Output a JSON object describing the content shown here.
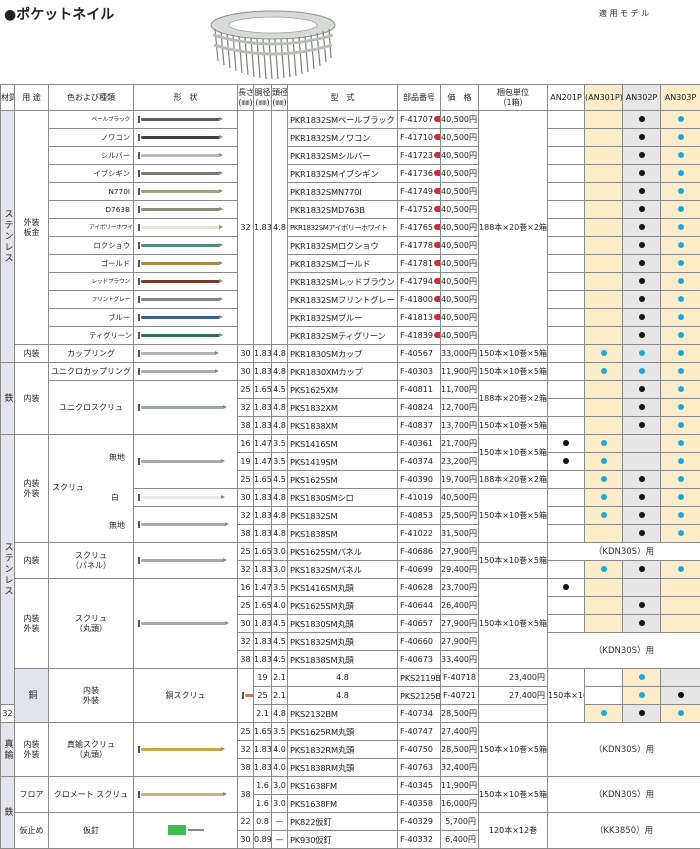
{
  "title": "●ポケットネイル",
  "headers": {
    "material": "材質",
    "use": "用 途",
    "color_type": "色および種類",
    "shape": "形　状",
    "length": "長さ",
    "length_unit": "(㎜)",
    "shank": "胴径",
    "shank_unit": "(㎜)",
    "head": "頭径",
    "head_unit": "(㎜)",
    "model": "型　式",
    "part_no": "部品番号",
    "price": "価　格",
    "package": "梱包単位",
    "package_sub": "（1箱）",
    "applicable": "適 用 モ デ ル",
    "models": [
      "AN201P",
      "(AN301P)",
      "AN302P",
      "AN303P"
    ]
  },
  "materials": {
    "stainless": "ステンレス",
    "iron": "鉄",
    "copper": "銅",
    "brass": "真鍮"
  },
  "uses": {
    "exterior_board": "外装\n板金",
    "interior": "内装",
    "interior_exterior": "内装\n外装",
    "floor": "フロア",
    "temp_stop": "仮止め"
  },
  "types": {
    "ring": "リング",
    "cup_ring": "カップリング",
    "unichro_cup_ring": "ユニクロカップリング",
    "unichro_screw": "ユニクロスクリュ",
    "screw": "スクリュ",
    "screw_panel": "スクリュ\n（パネル）",
    "screw_round": "スクリュ\n（丸頭）",
    "copper_screw": "銅スクリュ",
    "brass_screw": "真鍮スクリュ\n（丸頭）",
    "chromate_screw": "クロメート スクリュ",
    "temp_nail": "仮釘",
    "plain": "無地",
    "white": "白"
  },
  "ring_rows": [
    {
      "color": "ペールブラック",
      "model": "PKR1832SMペールブラック",
      "part": "F-41707",
      "price": "40,500円"
    },
    {
      "color": "ノワコン",
      "model": "PKR1832SMノワコン",
      "part": "F-41710",
      "price": "40,500円"
    },
    {
      "color": "シルバー",
      "model": "PKR1832SMシルバー",
      "part": "F-41723",
      "price": "40,500円"
    },
    {
      "color": "イブシギン",
      "model": "PKR1832SMイブシギン",
      "part": "F-41736",
      "price": "40,500円"
    },
    {
      "color": "N770I",
      "model": "PKR1832SMN770I",
      "part": "F-41749",
      "price": "40,500円"
    },
    {
      "color": "D763B",
      "model": "PKR1832SMD763B",
      "part": "F-41752",
      "price": "40,500円"
    },
    {
      "color": "アイボリーホワイト",
      "model": "PKR1832SMアイボリーホワイト",
      "part": "F-41765",
      "price": "40,500円"
    },
    {
      "color": "ロクショウ",
      "model": "PKR1832SMロクショウ",
      "part": "F-41778",
      "price": "40,500円"
    },
    {
      "color": "ゴールド",
      "model": "PKR1832SMゴールド",
      "part": "F-41781",
      "price": "40,500円"
    },
    {
      "color": "レッドブラウン",
      "model": "PKR1832SMレッドブラウン",
      "part": "F-41794",
      "price": "40,500円"
    },
    {
      "color": "フリントグレー",
      "model": "PKR1832SMフリントグレー",
      "part": "F-41800",
      "price": "40,500円"
    },
    {
      "color": "ブルー",
      "model": "PKR1832SMブルー",
      "part": "F-41813",
      "price": "40,500円"
    },
    {
      "color": "ティグリーン",
      "model": "PKR1832SMティグリーン",
      "part": "F-41839",
      "price": "40,500円"
    }
  ],
  "ring_dims": {
    "length": "32",
    "shank": "1.83",
    "head": "4.8",
    "package": "188本×20巻×2箱"
  },
  "cup_row": {
    "length": "30",
    "shank": "1.83",
    "head": "4.8",
    "model": "PKR1830SMカップ",
    "part": "F-40567",
    "price": "33,000円",
    "package": "150本×10巻×5箱"
  },
  "iron_rows": [
    {
      "length": "30",
      "shank": "1.83",
      "head": "4.8",
      "model": "PKR1830XMカップ",
      "part": "F-40303",
      "price": "11,900円",
      "package": "150本×10巻×5箱"
    },
    {
      "length": "25",
      "shank": "1.65",
      "head": "4.5",
      "model": "PKS1625XM",
      "part": "F-40811",
      "price": "11,700円",
      "package": "188本×20巻×2箱"
    },
    {
      "length": "32",
      "shank": "1.83",
      "head": "4.8",
      "model": "PKS1832XM",
      "part": "F-40824",
      "price": "12,700円"
    },
    {
      "length": "38",
      "shank": "1.83",
      "head": "4.8",
      "model": "PKS1838XM",
      "part": "F-40837",
      "price": "13,700円",
      "package": "150本×10巻×5箱"
    }
  ],
  "screw_rows": [
    {
      "length": "16",
      "shank": "1.47",
      "head": "3.5",
      "model": "PKS1416SM",
      "part": "F-40361",
      "price": "21,700円"
    },
    {
      "length": "19",
      "shank": "1.47",
      "head": "3.5",
      "model": "PKS1419SM",
      "part": "F-40374",
      "price": "23,200円"
    },
    {
      "length": "25",
      "shank": "1.65",
      "head": "4.5",
      "model": "PKS1625SM",
      "part": "F-40390",
      "price": "19,700円"
    },
    {
      "length": "30",
      "shank": "1.83",
      "head": "4.8",
      "model": "PKS1830SMシロ",
      "part": "F-41019",
      "price": "40,500円"
    },
    {
      "length": "32",
      "shank": "1.83",
      "head": "4.8",
      "model": "PKS1832SM",
      "part": "F-40853",
      "price": "25,500円"
    },
    {
      "length": "38",
      "shank": "1.83",
      "head": "4.8",
      "model": "PKS1838SM",
      "part": "F-41022",
      "price": "31,500円"
    }
  ],
  "screw_packages": {
    "p1": "150本×10巻×5箱",
    "p2": "188本×20巻×2箱",
    "p3": "150本×10巻×5箱"
  },
  "panel_rows": [
    {
      "length": "25",
      "shank": "1.65",
      "head": "3.0",
      "model": "PKS1625SMパネル",
      "part": "F-40686",
      "price": "27,900円"
    },
    {
      "length": "32",
      "shank": "1.83",
      "head": "3.0",
      "model": "PKS1832SMパネル",
      "part": "F-40699",
      "price": "29,400円"
    }
  ],
  "round_rows": [
    {
      "length": "16",
      "shank": "1.47",
      "head": "3.5",
      "model": "PKS1416SM丸頭",
      "part": "F-40628",
      "price": "23,700円"
    },
    {
      "length": "25",
      "shank": "1.65",
      "head": "4.0",
      "model": "PKS1625SM丸頭",
      "part": "F-40644",
      "price": "26,400円"
    },
    {
      "length": "30",
      "shank": "1.83",
      "head": "4.5",
      "model": "PKS1830SM丸頭",
      "part": "F-40657",
      "price": "27,900円"
    },
    {
      "length": "32",
      "shank": "1.83",
      "head": "4.5",
      "model": "PKS1832SM丸頭",
      "part": "F-40660",
      "price": "27,900円"
    },
    {
      "length": "38",
      "shank": "1.83",
      "head": "4.5",
      "model": "PKS1838SM丸頭",
      "part": "F-40673",
      "price": "33,400円"
    }
  ],
  "copper_rows": [
    {
      "length": "19",
      "shank": "2.1",
      "head": "4.8",
      "model": "PKS2119BM",
      "part": "F-40718",
      "price": "23,400円"
    },
    {
      "length": "25",
      "shank": "2.1",
      "head": "4.8",
      "model": "PKS2125BM",
      "part": "F-40721",
      "price": "27,400円"
    },
    {
      "length": "32",
      "shank": "2.1",
      "head": "4.8",
      "model": "PKS2132BM",
      "part": "F-40734",
      "price": "28,500円"
    }
  ],
  "brass_rows": [
    {
      "length": "25",
      "shank": "1.65",
      "head": "3.5",
      "model": "PKS1625RM丸頭",
      "part": "F-40747",
      "price": "27,400円"
    },
    {
      "length": "32",
      "shank": "1.83",
      "head": "4.0",
      "model": "PKS1832RM丸頭",
      "part": "F-40750",
      "price": "28,500円"
    },
    {
      "length": "38",
      "shank": "1.83",
      "head": "4.0",
      "model": "PKS1838RM丸頭",
      "part": "F-40763",
      "price": "32,400円"
    }
  ],
  "floor_rows": [
    {
      "length": "38",
      "shank": "1.6",
      "head": "3.0",
      "model": "PKS1638FM",
      "part": "F-40345",
      "price": "11,900円"
    },
    {
      "shank": "1.6",
      "head": "3.0",
      "model": "PKS1638FM",
      "part": "F-40358",
      "price": "16,000円"
    }
  ],
  "temp_rows": [
    {
      "length": "22",
      "shank": "0.8",
      "head": "—",
      "model": "PK822仮釘",
      "part": "F-40329",
      "price": "5,700円"
    },
    {
      "length": "30",
      "shank": "0.89",
      "head": "—",
      "model": "PK930仮釘",
      "part": "F-40332",
      "price": "6,400円"
    }
  ],
  "packages": {
    "p150": "150本×10巻×5箱",
    "p120": "120本×12巻"
  },
  "notes": {
    "kdn30s": "（KDN30S）用",
    "kk3850": "（KK3850）用"
  },
  "colors": {
    "dot_black": "#111111",
    "dot_blue": "#1ba8e0",
    "an301p_bg": "#fcecc8",
    "an302p_bg": "#e6e6e6",
    "new_badge": "#d0303a",
    "cap_green": "#3bbf55"
  }
}
